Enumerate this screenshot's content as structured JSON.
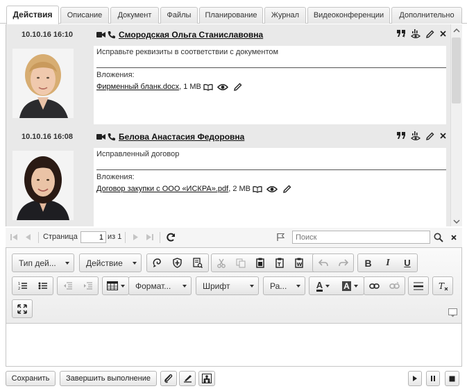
{
  "tabs": [
    {
      "label": "Действия",
      "active": true
    },
    {
      "label": "Описание"
    },
    {
      "label": "Документ"
    },
    {
      "label": "Файлы"
    },
    {
      "label": "Планирование"
    },
    {
      "label": "Журнал"
    },
    {
      "label": "Видеоконференции"
    },
    {
      "label": "Дополнительно"
    }
  ],
  "entries": [
    {
      "date": "10.10.16 16:10",
      "author": "Смородская Ольга Станиславовна",
      "text": "Исправьте реквизиты в соответствии с документом",
      "attachments_label": "Вложения:",
      "file_name": "Фирменный бланк.docx",
      "file_size": ", 1 MB"
    },
    {
      "date": "10.10.16 16:08",
      "author": "Белова Анастасия Федоровна",
      "text": "Исправленный договор",
      "attachments_label": "Вложения:",
      "file_name": "Договор закупки с ООО «ИСКРА».pdf",
      "file_size": ", 2 MB"
    }
  ],
  "pager": {
    "page_label": "Страница",
    "page_value": "1",
    "of_label": "из 1",
    "search_placeholder": "Поиск"
  },
  "toolbar": {
    "type_dropdown": "Тип дей...",
    "action_dropdown": "Действие",
    "format_dropdown": "Формат...",
    "font_dropdown": "Шрифт",
    "size_dropdown": "Ра...",
    "text_color": "A",
    "bg_color": "A",
    "bold": "B",
    "italic": "I",
    "underline": "U"
  },
  "buttons": {
    "save": "Сохранить",
    "complete": "Завершить выполнение"
  },
  "colors": {
    "tab_border": "#c6c6c6",
    "feed_bg": "#e9e9e9",
    "icon": "#222222"
  }
}
